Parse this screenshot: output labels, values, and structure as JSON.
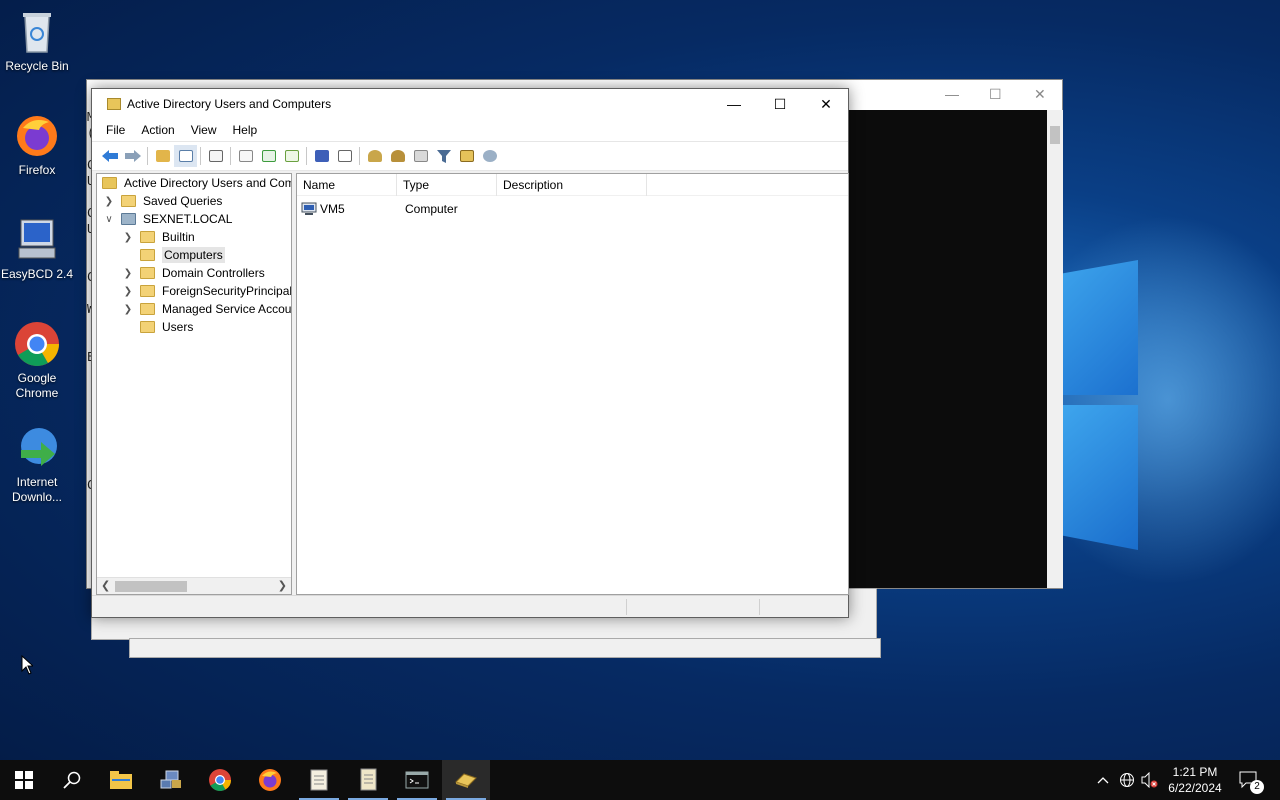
{
  "desktop": {
    "icons": [
      {
        "label": "Recycle Bin"
      },
      {
        "label": "Firefox"
      },
      {
        "label": "EasyBCD 2.4"
      },
      {
        "label": "Google Chrome"
      },
      {
        "label": "Internet Downlo..."
      }
    ]
  },
  "console_letters": [
    "M",
    "(",
    "C",
    "U",
    "C",
    "U",
    "C",
    "W",
    "E",
    "C"
  ],
  "window": {
    "title": "Active Directory Users and Computers",
    "menu": [
      "File",
      "Action",
      "View",
      "Help"
    ],
    "tree": {
      "root": "Active Directory Users and Com",
      "saved_queries": "Saved Queries",
      "domain": "SEXNET.LOCAL",
      "items": [
        "Builtin",
        "Computers",
        "Domain Controllers",
        "ForeignSecurityPrincipals",
        "Managed Service Accour",
        "Users"
      ],
      "selected": "Computers"
    },
    "list": {
      "columns": [
        "Name",
        "Type",
        "Description"
      ],
      "rows": [
        {
          "name": "VM5",
          "type": "Computer",
          "description": ""
        }
      ]
    }
  },
  "taskbar": {
    "clock_time": "1:21 PM",
    "clock_date": "6/22/2024",
    "notification_count": "2"
  },
  "colors": {
    "accent": "#7aa9e0",
    "folder": "#f3d276"
  }
}
